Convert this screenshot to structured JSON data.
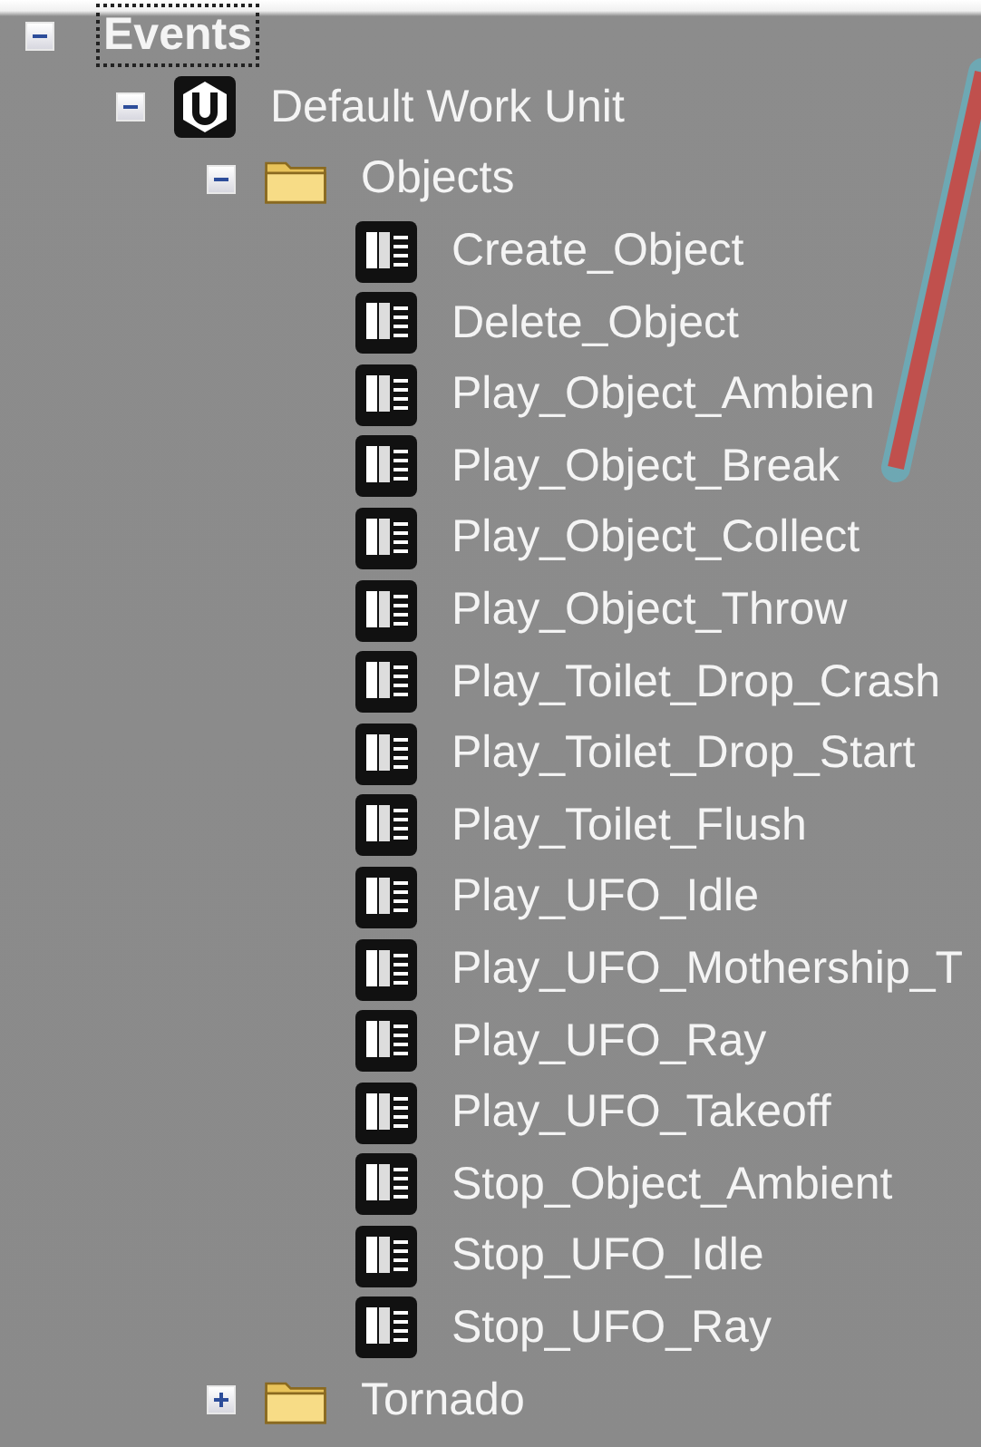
{
  "tree": [
    {
      "kind": "root",
      "label": "Events",
      "expanded": true,
      "selected": true,
      "children": [
        {
          "kind": "workunit",
          "label": "Default Work Unit",
          "expanded": true,
          "selected": false,
          "children": [
            {
              "kind": "folder",
              "label": "Objects",
              "expanded": true,
              "selected": false,
              "children": [
                {
                  "kind": "event",
                  "label": "Create_Object",
                  "selected": false
                },
                {
                  "kind": "event",
                  "label": "Delete_Object",
                  "selected": false
                },
                {
                  "kind": "event",
                  "label": "Play_Object_Ambien",
                  "selected": false
                },
                {
                  "kind": "event",
                  "label": "Play_Object_Break",
                  "selected": false
                },
                {
                  "kind": "event",
                  "label": "Play_Object_Collect",
                  "selected": false
                },
                {
                  "kind": "event",
                  "label": "Play_Object_Throw",
                  "selected": false
                },
                {
                  "kind": "event",
                  "label": "Play_Toilet_Drop_Crash",
                  "selected": false
                },
                {
                  "kind": "event",
                  "label": "Play_Toilet_Drop_Start",
                  "selected": false
                },
                {
                  "kind": "event",
                  "label": "Play_Toilet_Flush",
                  "selected": false
                },
                {
                  "kind": "event",
                  "label": "Play_UFO_Idle",
                  "selected": false
                },
                {
                  "kind": "event",
                  "label": "Play_UFO_Mothership_T",
                  "selected": false
                },
                {
                  "kind": "event",
                  "label": "Play_UFO_Ray",
                  "selected": false
                },
                {
                  "kind": "event",
                  "label": "Play_UFO_Takeoff",
                  "selected": false
                },
                {
                  "kind": "event",
                  "label": "Stop_Object_Ambient",
                  "selected": false
                },
                {
                  "kind": "event",
                  "label": "Stop_UFO_Idle",
                  "selected": false
                },
                {
                  "kind": "event",
                  "label": "Stop_UFO_Ray",
                  "selected": false
                }
              ]
            },
            {
              "kind": "folder",
              "label": "Tornado",
              "expanded": false,
              "selected": false
            }
          ]
        }
      ]
    }
  ]
}
